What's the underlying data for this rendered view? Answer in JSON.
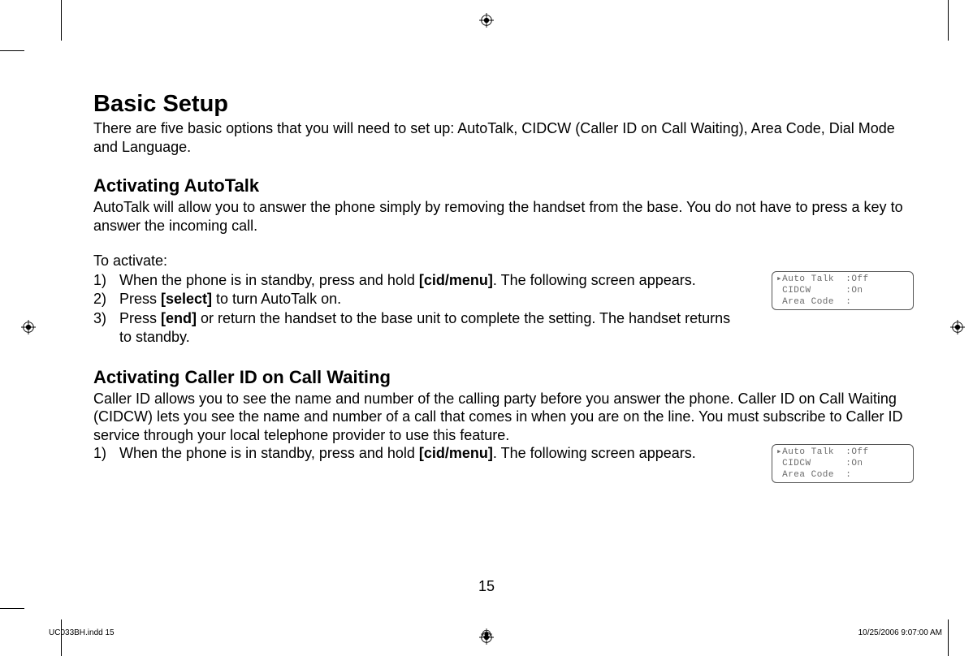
{
  "heading_main": "Basic Setup",
  "intro": "There are five basic options that you will need to set up: AutoTalk, CIDCW (Caller ID on Call Waiting), Area Code, Dial Mode and Language.",
  "section_autotalk": {
    "heading": "Activating AutoTalk",
    "body": "AutoTalk will allow you to answer the phone simply by removing the handset from the base. You do not have to press a key to answer the incoming call.",
    "lead": "To activate:",
    "steps": [
      {
        "num": "1)",
        "pre": "When the phone is in standby, press and hold ",
        "bold": "[cid/menu]",
        "post": ". The following screen appears."
      },
      {
        "num": "2)",
        "pre": "Press ",
        "bold": "[select]",
        "post": " to turn AutoTalk on."
      },
      {
        "num": "3)",
        "pre": "Press ",
        "bold": "[end]",
        "post": " or return the handset to the base unit to complete the setting. The handset returns to standby."
      }
    ]
  },
  "section_cidcw": {
    "heading": "Activating Caller ID on Call Waiting",
    "body": "Caller ID allows you to see the name and number of the calling party before you answer the phone. Caller ID on Call Waiting (CIDCW) lets you see the name and number of a call that comes in when you are on the line. You must subscribe to Caller ID service through your local telephone provider to use this feature.",
    "steps": [
      {
        "num": "1)",
        "pre": "When the phone is in standby, press and hold ",
        "bold": "[cid/menu]",
        "post": ". The following screen appears."
      }
    ]
  },
  "lcd1": "▸Auto Talk  :Off\n CIDCW      :On\n Area Code  :",
  "lcd2": "▸Auto Talk  :Off\n CIDCW      :On\n Area Code  :",
  "page_number": "15",
  "footer_left": "UC033BH.indd   15",
  "footer_right": "10/25/2006   9:07:00 AM"
}
